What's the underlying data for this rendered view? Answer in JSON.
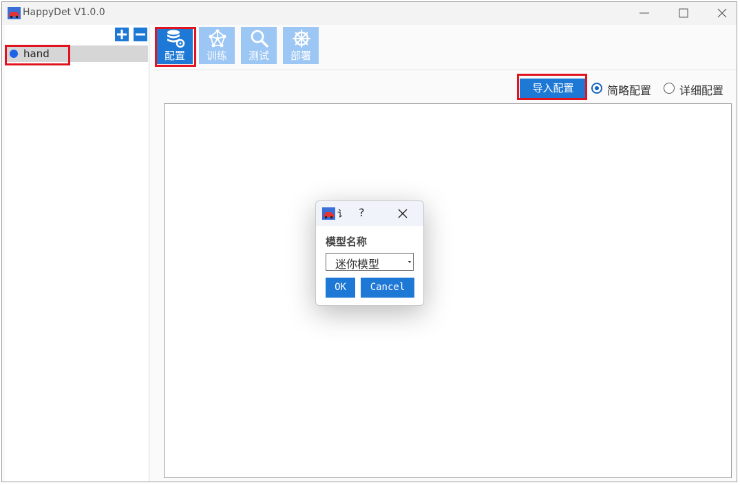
{
  "window": {
    "title": "HappyDet V1.0.0"
  },
  "tree": {
    "items": [
      {
        "label": "hand"
      }
    ]
  },
  "toolbar": {
    "tools": [
      {
        "label": "配置",
        "icon": "database-gear-icon"
      },
      {
        "label": "训练",
        "icon": "network-icon"
      },
      {
        "label": "测试",
        "icon": "magnifier-icon"
      },
      {
        "label": "部署",
        "icon": "ship-wheel-icon"
      }
    ]
  },
  "config": {
    "import_label": "导入配置",
    "radio_simple": "简略配置",
    "radio_detailed": "详细配置"
  },
  "dialog": {
    "title": "讠",
    "help": "?",
    "label": "模型名称",
    "select_value": "迷你模型",
    "ok": "OK",
    "cancel": "Cancel"
  },
  "colors": {
    "accent": "#1e78d6",
    "highlight": "#e0141e",
    "tool_inactive": "#9cc6f3"
  }
}
